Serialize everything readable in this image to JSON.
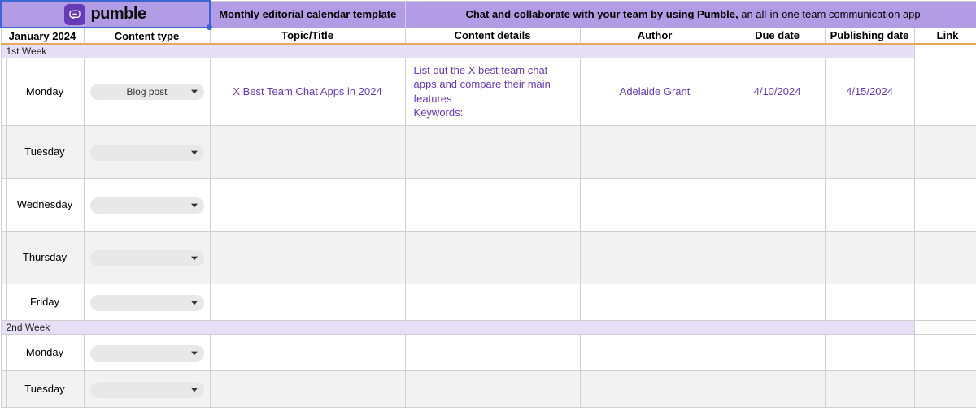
{
  "banner": {
    "logo_text": "pumble",
    "title": "Monthly editorial calendar template",
    "promo_bold": "Chat and collaborate with your team by using Pumble,",
    "promo_rest": " an all-in-one team communication app"
  },
  "headers": {
    "month": "January 2024",
    "content_type": "Content type",
    "topic": "Topic/Title",
    "details": "Content details",
    "author": "Author",
    "due": "Due date",
    "pub": "Publishing date",
    "link": "Link"
  },
  "weeks": [
    {
      "label": "1st Week",
      "rows": [
        {
          "day": "Monday",
          "content_type": "Blog post",
          "topic": "X Best Team Chat Apps in 2024",
          "details": "List out the X best team chat apps and compare their main features\nKeywords:",
          "author": "Adelaide Grant",
          "due": "4/10/2024",
          "pub": "4/15/2024",
          "alt": false
        },
        {
          "day": "Tuesday",
          "content_type": "",
          "alt": true
        },
        {
          "day": "Wednesday",
          "content_type": "",
          "alt": false
        },
        {
          "day": "Thursday",
          "content_type": "",
          "alt": true
        },
        {
          "day": "Friday",
          "content_type": "",
          "alt": false,
          "short": true
        }
      ]
    },
    {
      "label": "2nd Week",
      "rows": [
        {
          "day": "Monday",
          "content_type": "",
          "alt": false,
          "short": true
        },
        {
          "day": "Tuesday",
          "content_type": "",
          "alt": true,
          "short": true
        }
      ]
    }
  ]
}
